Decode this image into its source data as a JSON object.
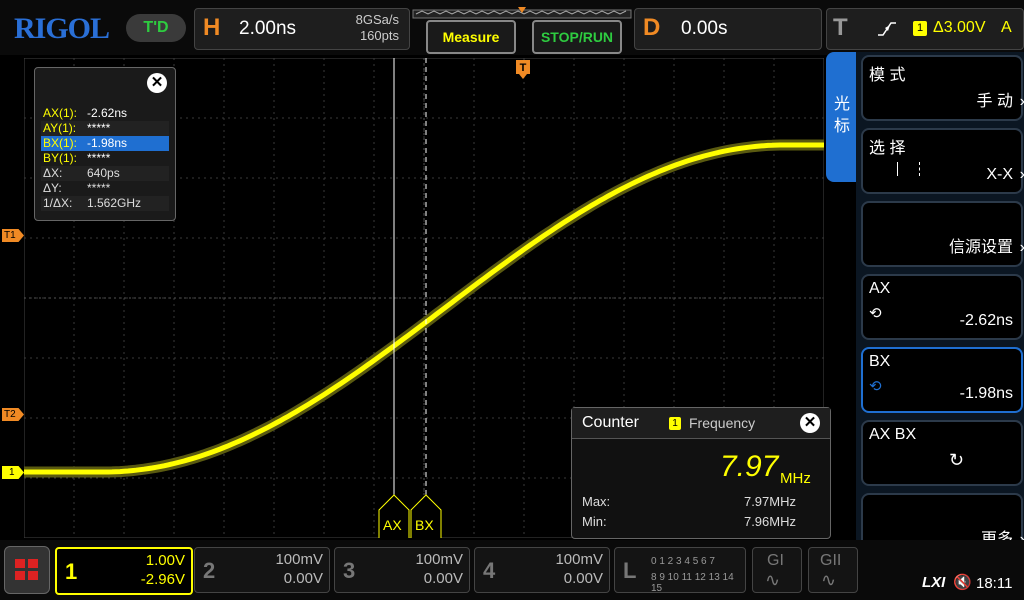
{
  "brand": "RIGOL",
  "trigger_mode": "T'D",
  "horizontal": {
    "letter": "H",
    "timebase": "2.00ns",
    "sample_rate": "8GSa/s",
    "memory_depth": "160pts"
  },
  "buttons": {
    "measure": "Measure",
    "stop_run": "STOP/RUN"
  },
  "delay": {
    "letter": "D",
    "value": "0.00s"
  },
  "trigger": {
    "letter": "T",
    "channel": "1",
    "level": "Δ3.00V",
    "coupling": "A"
  },
  "markers": {
    "t1": "T1",
    "t2": "T2",
    "ch1": "1",
    "ax": "AX",
    "bx": "BX"
  },
  "cursor_panel": {
    "rows": [
      {
        "key": "AX(1):",
        "value": "-2.62ns"
      },
      {
        "key": "AY(1):",
        "value": "*****"
      },
      {
        "key": "BX(1):",
        "value": "-1.98ns"
      },
      {
        "key": "BY(1):",
        "value": "*****"
      },
      {
        "key": "ΔX:",
        "value": "640ps"
      },
      {
        "key": "ΔY:",
        "value": "*****"
      },
      {
        "key": "1/ΔX:",
        "value": "1.562GHz"
      }
    ]
  },
  "counter": {
    "title": "Counter",
    "channel": "1",
    "mode": "Frequency",
    "value": "7.97",
    "unit": "MHz",
    "max_label": "Max:",
    "max_value": "7.97MHz",
    "min_label": "Min:",
    "min_value": "7.96MHz"
  },
  "side_menu": {
    "tab": "光 标",
    "items": [
      {
        "label": "模 式",
        "value": "手 动"
      },
      {
        "label": "选 择",
        "value": "X-X"
      },
      {
        "label": "",
        "value": "信源设置"
      },
      {
        "label": "AX",
        "value": "-2.62ns"
      },
      {
        "label": "BX",
        "value": "-1.98ns"
      },
      {
        "label": "AX BX",
        "value": ""
      },
      {
        "label": "",
        "value": "更多"
      }
    ]
  },
  "channels": [
    {
      "num": "1",
      "scale": "1.00V",
      "offset": "-2.96V"
    },
    {
      "num": "2",
      "scale": "100mV",
      "offset": "0.00V"
    },
    {
      "num": "3",
      "scale": "100mV",
      "offset": "0.00V"
    },
    {
      "num": "4",
      "scale": "100mV",
      "offset": "0.00V"
    }
  ],
  "logic": {
    "letter": "L",
    "row1": "0 1 2 3  4 5 6 7",
    "row2": "8 9 10 11 12 13 14 15"
  },
  "generators": {
    "g1": "GI",
    "g2": "GII"
  },
  "status": {
    "lxi": "LXI",
    "time": "18:11"
  },
  "colors": {
    "ch1": "#ffff00",
    "accent": "#f08a24",
    "menu_blue": "#1f6fd1",
    "green": "#2ecc40"
  }
}
